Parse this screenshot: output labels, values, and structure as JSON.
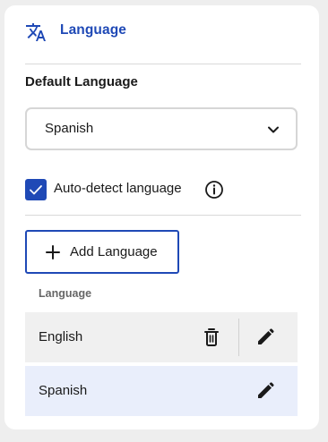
{
  "header": {
    "title": "Language",
    "icon": "translate-icon",
    "accent": "#1f49b6"
  },
  "default_language": {
    "label": "Default Language",
    "selected": "Spanish"
  },
  "auto_detect": {
    "label": "Auto-detect language",
    "checked": true
  },
  "add_button": {
    "label": "Add Language"
  },
  "table": {
    "column_header": "Language",
    "rows": [
      {
        "name": "English",
        "actions": [
          "delete",
          "edit"
        ]
      },
      {
        "name": "Spanish",
        "actions": [
          "edit"
        ]
      }
    ]
  }
}
